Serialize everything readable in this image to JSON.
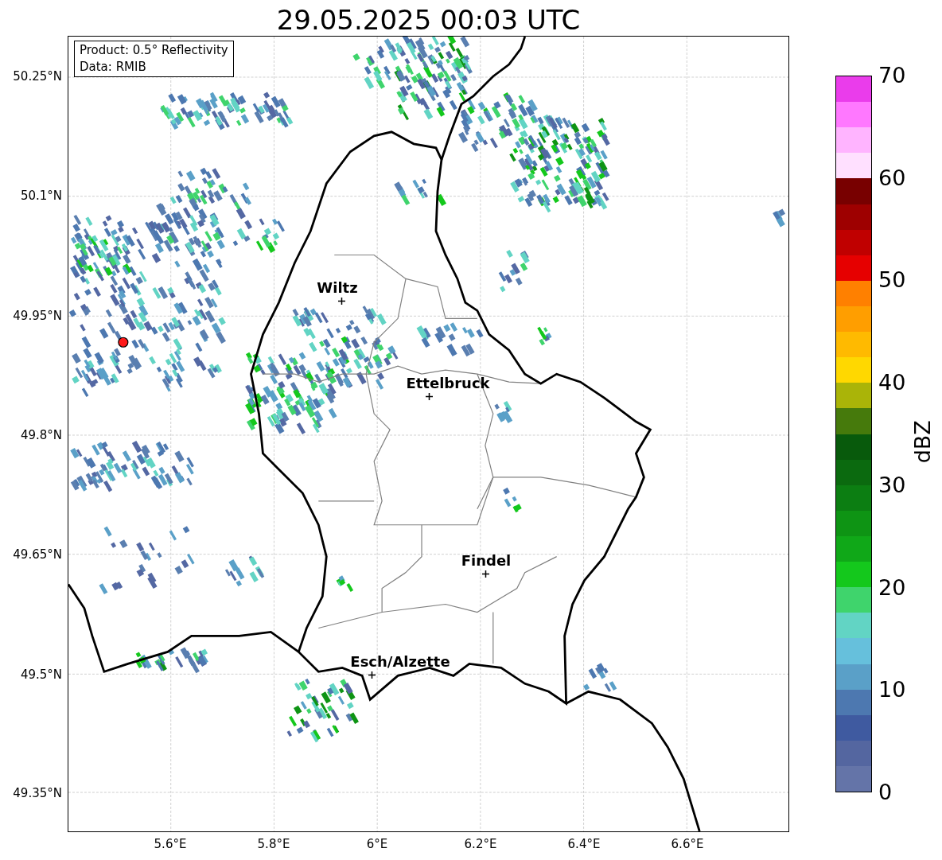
{
  "title": "29.05.2025 00:03 UTC",
  "info_box": {
    "lines": [
      "Product: 0.5° Reflectivity",
      "Data: RMIB"
    ]
  },
  "map": {
    "places": [
      {
        "name": "Wiltz"
      },
      {
        "name": "Ettelbruck"
      },
      {
        "name": "Findel"
      },
      {
        "name": "Esch/Alzette"
      }
    ]
  },
  "x_axis": {
    "ticks": [
      "5.6°E",
      "5.8°E",
      "6°E",
      "6.2°E",
      "6.4°E",
      "6.6°E"
    ]
  },
  "y_axis": {
    "ticks": [
      "50.25°N",
      "50.1°N",
      "49.95°N",
      "49.8°N",
      "49.65°N",
      "49.5°N",
      "49.35°N"
    ]
  },
  "colorbar": {
    "label": "dBZ",
    "ticks": [
      "70",
      "60",
      "50",
      "40",
      "30",
      "20",
      "10",
      "0"
    ],
    "bands": [
      {
        "color": "#ea3ceb"
      },
      {
        "color": "#ff78ff"
      },
      {
        "color": "#ffb4ff"
      },
      {
        "color": "#ffe0ff"
      },
      {
        "color": "#780000"
      },
      {
        "color": "#9e0000"
      },
      {
        "color": "#c00000"
      },
      {
        "color": "#e60000"
      },
      {
        "color": "#ff8000"
      },
      {
        "color": "#ff9e00"
      },
      {
        "color": "#ffba00"
      },
      {
        "color": "#ffd800"
      },
      {
        "color": "#aab408"
      },
      {
        "color": "#467a0c"
      },
      {
        "color": "#085a0c"
      },
      {
        "color": "#0b6a0f"
      },
      {
        "color": "#0c7e12"
      },
      {
        "color": "#0e9414"
      },
      {
        "color": "#10a818"
      },
      {
        "color": "#14c81c"
      },
      {
        "color": "#3fd46c"
      },
      {
        "color": "#62d4c4"
      },
      {
        "color": "#66c0dc"
      },
      {
        "color": "#5aa0c8"
      },
      {
        "color": "#4d78b0"
      },
      {
        "color": "#3f5aa0"
      },
      {
        "color": "#5466a0"
      },
      {
        "color": "#6474a8"
      }
    ]
  }
}
